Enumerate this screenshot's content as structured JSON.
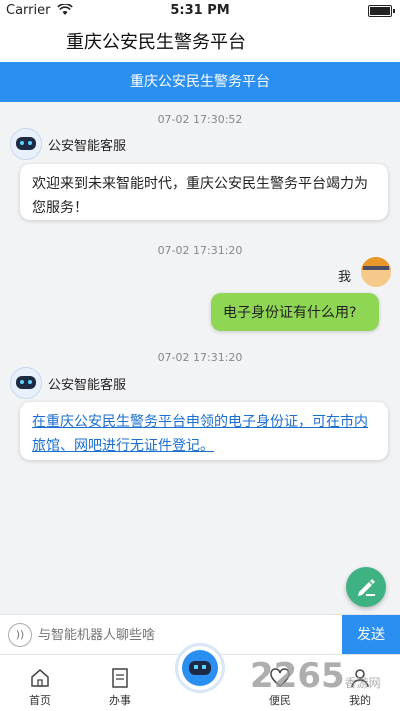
{
  "status_bar": {
    "carrier": "Carrier",
    "time": "5:31 PM"
  },
  "app": {
    "title": "重庆公安民生警务平台"
  },
  "nav": {
    "title": "重庆公安民生警务平台"
  },
  "messages": [
    {
      "timestamp": "07-02 17:30:52",
      "sender": "公安智能客服",
      "text": "欢迎来到未来智能时代，重庆公安民生警务平台竭力为您服务！"
    },
    {
      "timestamp": "07-02 17:31:20",
      "sender": "我",
      "text": "电子身份证有什么用?"
    },
    {
      "timestamp": "07-02 17:31:20",
      "sender": "公安智能客服",
      "text": "在重庆公安民生警务平台申领的电子身份证，可在市内旅馆、网吧进行无证件登记。"
    }
  ],
  "input": {
    "placeholder": "与智能机器人聊些啥",
    "send_label": "发送"
  },
  "tabs": [
    {
      "label": "首页",
      "icon": "home-icon"
    },
    {
      "label": "办事",
      "icon": "document-icon"
    },
    {
      "label": "",
      "icon": "robot-icon"
    },
    {
      "label": "便民",
      "icon": "heart-icon"
    },
    {
      "label": "我的",
      "icon": "user-icon"
    }
  ],
  "watermark": {
    "text": "2265",
    "sub": "香游网"
  },
  "colors": {
    "accent": "#2a8ff1",
    "user_bubble": "#8ed654",
    "fab": "#3fb283"
  }
}
